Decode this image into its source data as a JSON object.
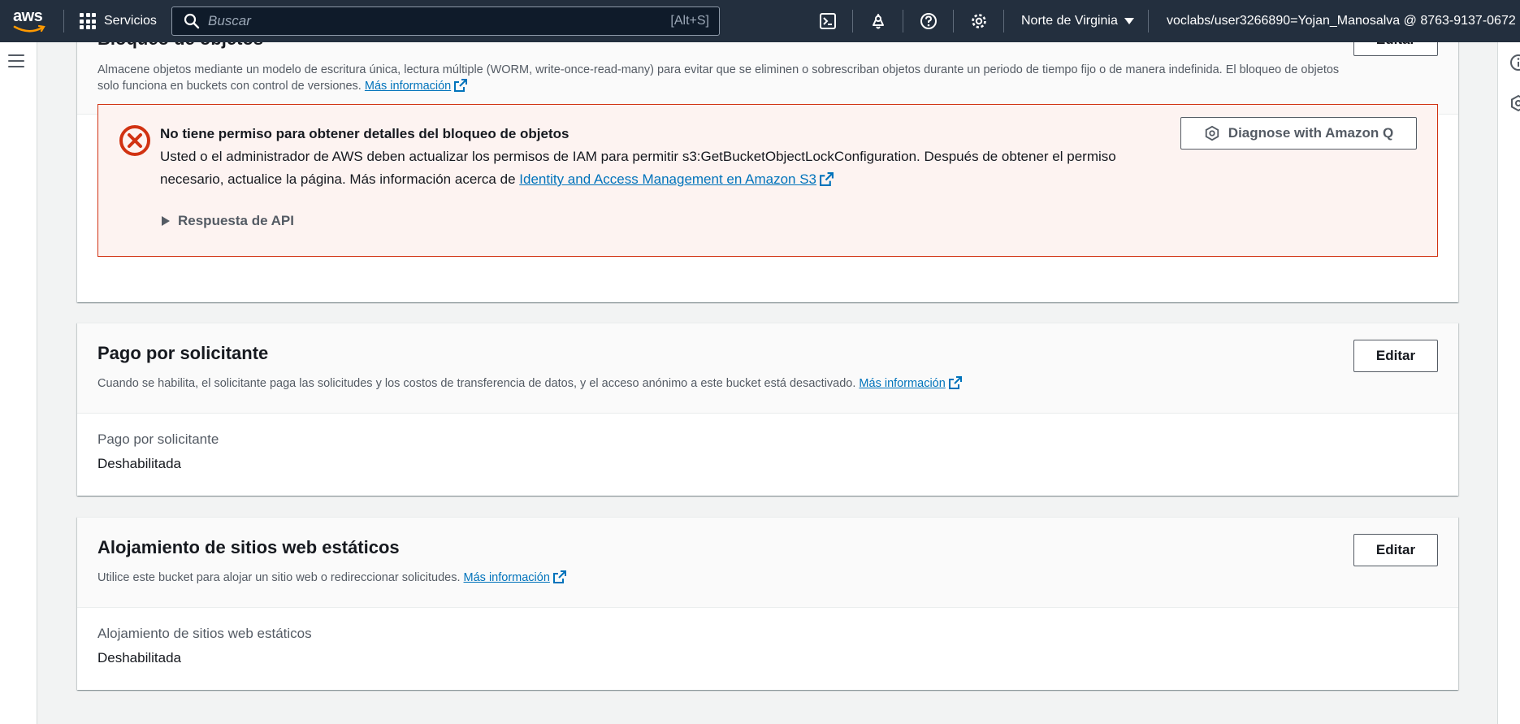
{
  "topnav": {
    "logo_text": "aws",
    "services_label": "Servicios",
    "search_placeholder": "Buscar",
    "search_shortcut": "[Alt+S]",
    "region_label": "Norte de Virginia",
    "account_label": "voclabs/user3266890=Yojan_Manosalva @ 8763-9137-0672",
    "icons": [
      "cloudshell-icon",
      "bell-icon",
      "help-icon",
      "gear-icon"
    ]
  },
  "object_lock": {
    "title": "Bloqueo de objetos",
    "edit_label": "Editar",
    "desc_line1": "Almacene objetos mediante un modelo de escritura única, lectura múltiple (WORM, write-once-read-many) para evitar que se eliminen o sobrescriban objetos durante un periodo de tiempo fijo o de manera indefinida. El bloqueo de objetos",
    "desc_line2": "solo funciona en buckets con control de versiones.",
    "learn_more": "Más información",
    "alert": {
      "title": "No tiene permiso para obtener detalles del bloqueo de objetos",
      "body_line1": "Usted o el administrador de AWS deben actualizar los permisos de IAM para permitir s3:GetBucketObjectLockConfiguration. Después de obtener el permiso",
      "body_line2_prefix": "necesario, actualice la página. Más información acerca de",
      "body_link": "Identity and Access Management en Amazon S3",
      "expander_label": "Respuesta de API",
      "q_button_label": "Diagnose with Amazon Q",
      "color": "#d13212"
    }
  },
  "requester_pays": {
    "title": "Pago por solicitante",
    "edit_label": "Editar",
    "desc": "Cuando se habilita, el solicitante paga las solicitudes y los costos de transferencia de datos, y el acceso anónimo a este bucket está desactivado.",
    "learn_more": "Más información",
    "field_label": "Pago por solicitante",
    "field_value": "Deshabilitada"
  },
  "static_hosting": {
    "title": "Alojamiento de sitios web estáticos",
    "edit_label": "Editar",
    "desc": "Utilice este bucket para alojar un sitio web o redireccionar solicitudes.",
    "learn_more": "Más información",
    "field_label": "Alojamiento de sitios web estáticos",
    "field_value": "Deshabilitada"
  }
}
